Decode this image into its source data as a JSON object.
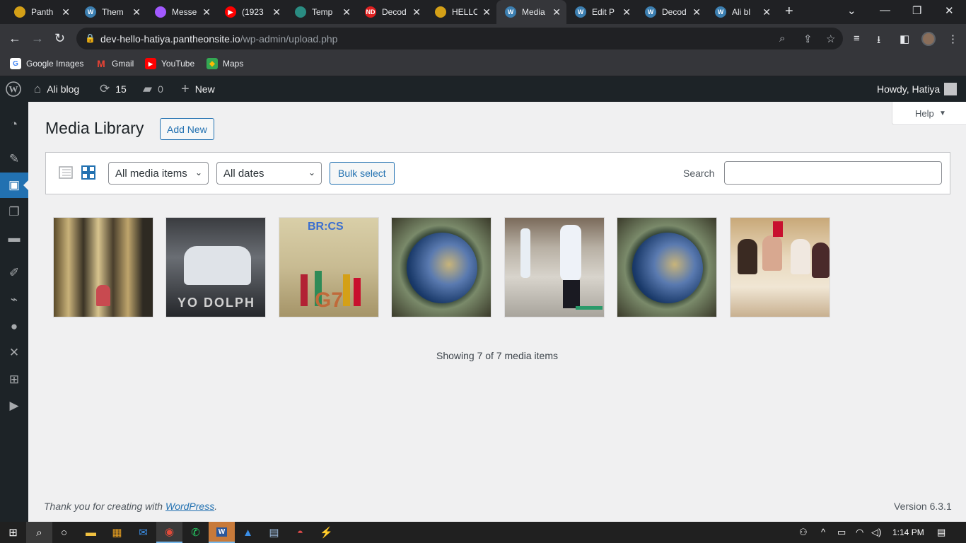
{
  "browser": {
    "tabs": [
      {
        "title": "Panth",
        "icon": "pantheon-icon",
        "color": "#d4a017"
      },
      {
        "title": "Them",
        "icon": "wordpress-icon",
        "color": "#3c7fb1"
      },
      {
        "title": "Messe",
        "icon": "messenger-icon",
        "color": "#a259ff"
      },
      {
        "title": "(1923",
        "icon": "youtube-icon",
        "color": "#ff0000"
      },
      {
        "title": "Temp",
        "icon": "template-icon",
        "color": "#2a8c82"
      },
      {
        "title": "Decod",
        "icon": "nd-icon",
        "color": "#e02020"
      },
      {
        "title": "HELLO",
        "icon": "pantheon-icon",
        "color": "#d4a017"
      },
      {
        "title": "Media",
        "icon": "wordpress-icon",
        "color": "#3c7fb1"
      },
      {
        "title": "Edit P",
        "icon": "wordpress-icon",
        "color": "#3c7fb1"
      },
      {
        "title": "Decod",
        "icon": "wordpress-icon",
        "color": "#3c7fb1"
      },
      {
        "title": "Ali bl",
        "icon": "wordpress-icon",
        "color": "#3c7fb1"
      }
    ],
    "active_tab_index": 7,
    "url_host": "dev-hello-hatiya.pantheonsite.io",
    "url_path": "/wp-admin/upload.php",
    "bookmarks": [
      {
        "label": "Google Images",
        "icon": "google-icon"
      },
      {
        "label": "Gmail",
        "icon": "gmail-icon"
      },
      {
        "label": "YouTube",
        "icon": "youtube-icon"
      },
      {
        "label": "Maps",
        "icon": "maps-icon"
      }
    ]
  },
  "adminbar": {
    "site_name": "Ali blog",
    "updates_count": "15",
    "comments_count": "0",
    "new_label": "New",
    "howdy": "Howdy, Hatiya"
  },
  "sidebar": {
    "items": [
      "dashboard-icon",
      "posts-icon",
      "media-icon",
      "pages-icon",
      "comments-icon",
      "appearance-icon",
      "plugins-icon",
      "users-icon",
      "tools-icon",
      "settings-icon",
      "play-icon"
    ],
    "current_index": 2
  },
  "page": {
    "help_label": "Help",
    "title": "Media Library",
    "add_new_label": "Add New",
    "filter_type": "All media items",
    "filter_date": "All dates",
    "bulk_select_label": "Bulk select",
    "search_label": "Search",
    "search_value": "",
    "media_items": [
      {
        "subject": "factory worker with golden threads"
      },
      {
        "subject": "white car at auto show"
      },
      {
        "subject": "BRICS G7 flags collage"
      },
      {
        "subject": "earth with money"
      },
      {
        "subject": "workers cleaning floor"
      },
      {
        "subject": "earth with money"
      },
      {
        "subject": "women at dinner table"
      }
    ],
    "showing_text": "Showing 7 of 7 media items",
    "footer_text": "Thank you for creating with ",
    "footer_link": "WordPress",
    "version": "Version 6.3.1"
  },
  "taskbar": {
    "time": "1:14 PM",
    "apps": [
      "windows-start-icon",
      "search-icon",
      "cortana-icon",
      "file-explorer-icon",
      "store-icon",
      "mail-icon",
      "chrome-icon",
      "whatsapp-icon",
      "word-icon",
      "photos-icon",
      "notepad-icon",
      "paint-icon",
      "pantheon-icon"
    ],
    "active_apps": [
      6,
      8
    ]
  },
  "colors": {
    "wp_blue": "#2271b1",
    "wp_dark": "#1d2327",
    "chrome_dark": "#202124"
  }
}
